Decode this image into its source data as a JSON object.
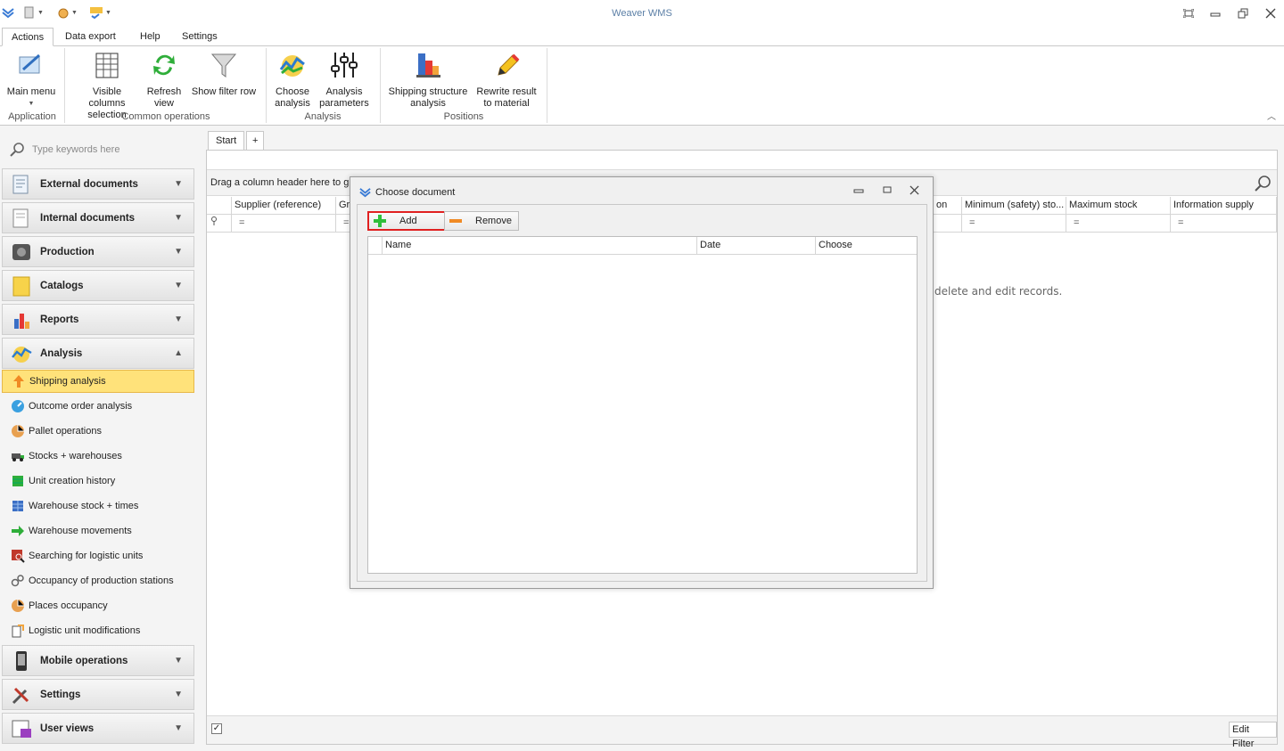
{
  "window": {
    "title": "Weaver WMS"
  },
  "ribbon_tabs": [
    "Actions",
    "Data export",
    "Help",
    "Settings"
  ],
  "ribbon": {
    "main_menu": "Main menu",
    "visible_columns_l1": "Visible columns",
    "visible_columns_l2": "selection",
    "refresh_l1": "Refresh",
    "refresh_l2": "view",
    "show_filter_row": "Show filter row",
    "choose_analysis_l1": "Choose",
    "choose_analysis_l2": "analysis",
    "analysis_params_l1": "Analysis",
    "analysis_params_l2": "parameters",
    "shipping_structure_l1": "Shipping structure",
    "shipping_structure_l2": "analysis",
    "rewrite_result_l1": "Rewrite result",
    "rewrite_result_l2": "to material",
    "groups": {
      "application": "Application",
      "common": "Common operations",
      "analysis": "Analysis",
      "positions": "Positions"
    }
  },
  "sidebar": {
    "search_placeholder": "Type keywords here",
    "groups_top": [
      "External documents",
      "Internal documents",
      "Production",
      "Catalogs",
      "Reports",
      "Analysis"
    ],
    "analysis_items": [
      "Shipping analysis",
      "Outcome order analysis",
      "Pallet operations",
      "Stocks + warehouses",
      "Unit creation history",
      "Warehouse stock + times",
      "Warehouse movements",
      "Searching for logistic units",
      "Occupancy of production stations",
      "Places occupancy",
      "Logistic unit modifications"
    ],
    "groups_bottom": [
      "Mobile operations",
      "Settings",
      "User views"
    ]
  },
  "main": {
    "doc_tab": "Start",
    "add_tab": "+",
    "group_hint": "Drag a column header here to gr",
    "columns_left": [
      "Supplier (reference)",
      "Gr"
    ],
    "columns_right": [
      "on",
      "Minimum (safety) sto...",
      "Maximum stock",
      "Information supply"
    ],
    "filter_symbol": "=",
    "empty_hint": "delete and edit records.",
    "edit_filter": "Edit Filter"
  },
  "dialog": {
    "title": "Choose document",
    "add_label": "Add",
    "remove_label": "Remove",
    "columns": [
      "Name",
      "Date",
      "Choose"
    ]
  },
  "colors": {
    "accent": "#ffe27a",
    "highlight_border": "#e02020",
    "title": "#5b7fa6"
  }
}
